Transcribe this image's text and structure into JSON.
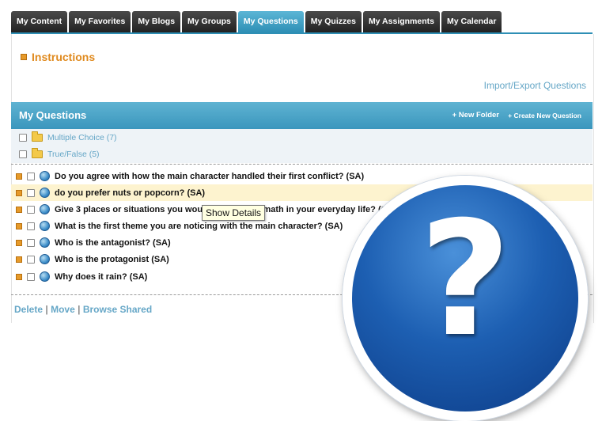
{
  "tabs": [
    {
      "label": "My Content",
      "active": false
    },
    {
      "label": "My Favorites",
      "active": false
    },
    {
      "label": "My Blogs",
      "active": false
    },
    {
      "label": "My Groups",
      "active": false
    },
    {
      "label": "My Questions",
      "active": true
    },
    {
      "label": "My Quizzes",
      "active": false
    },
    {
      "label": "My Assignments",
      "active": false
    },
    {
      "label": "My Calendar",
      "active": false
    }
  ],
  "instructions": {
    "label": "Instructions"
  },
  "import_export_link": "Import/Export Questions",
  "questions_bar": {
    "title": "My Questions",
    "new_folder": "+ New Folder",
    "create_question": "+ Create New Question"
  },
  "folders": [
    {
      "label": "Multiple Choice (7)"
    },
    {
      "label": "True/False (5)"
    }
  ],
  "questions": [
    {
      "text": "Do you agree with how the main character handled their first conflict? (SA)",
      "highlighted": false
    },
    {
      "text": "do you prefer nuts or popcorn? (SA)",
      "highlighted": true
    },
    {
      "text": "Give 3 places or situations you would have to use math in your everyday life? (SA)",
      "highlighted": false
    },
    {
      "text": "What is the first theme you are noticing with the main character? (SA)",
      "highlighted": false
    },
    {
      "text": "Who is the antagonist? (SA)",
      "highlighted": false
    },
    {
      "text": "Who is the protagonist (SA)",
      "highlighted": false
    },
    {
      "text": "Why does it rain? (SA)",
      "highlighted": false
    }
  ],
  "tooltip": "Show Details",
  "actions": {
    "delete": "Delete",
    "move": "Move",
    "browse_shared": "Browse Shared",
    "separator": "|"
  },
  "help_overlay": {
    "glyph": "?"
  },
  "colors": {
    "tab_active": "#2e8fb5",
    "accent_orange": "#e08a1e",
    "link_blue": "#66a7c7",
    "highlight_row": "#fdf3cf"
  }
}
